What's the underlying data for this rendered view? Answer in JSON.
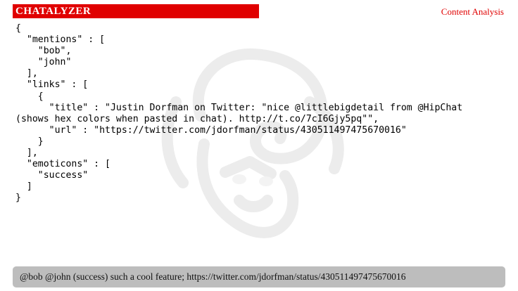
{
  "header": {
    "title": "CHATALYZER",
    "section": "Content Analysis"
  },
  "code": {
    "lines": [
      "{",
      "  \"mentions\" : [",
      "    \"bob\",",
      "    \"john\"",
      "  ],",
      "  \"links\" : [",
      "    {",
      "      \"title\" : \"Justin Dorfman on Twitter: \"nice @littlebigdetail from @HipChat",
      "(shows hex colors when pasted in chat). http://t.co/7cI6Gjy5pq\"\",",
      "      \"url\" : \"https://twitter.com/jdorfman/status/430511497475670016\"",
      "    }",
      "  ],",
      "  \"emoticons\" : [",
      "    \"success\"",
      "  ]",
      "}"
    ]
  },
  "message": {
    "text": "@bob @john (success) such a cool feature; https://twitter.com/jdorfman/status/430511497475670016"
  },
  "colors": {
    "accent": "#e00000",
    "message_bar_bg": "#bdbdbd"
  },
  "icons": {
    "watermark": "ram-head-logo"
  }
}
